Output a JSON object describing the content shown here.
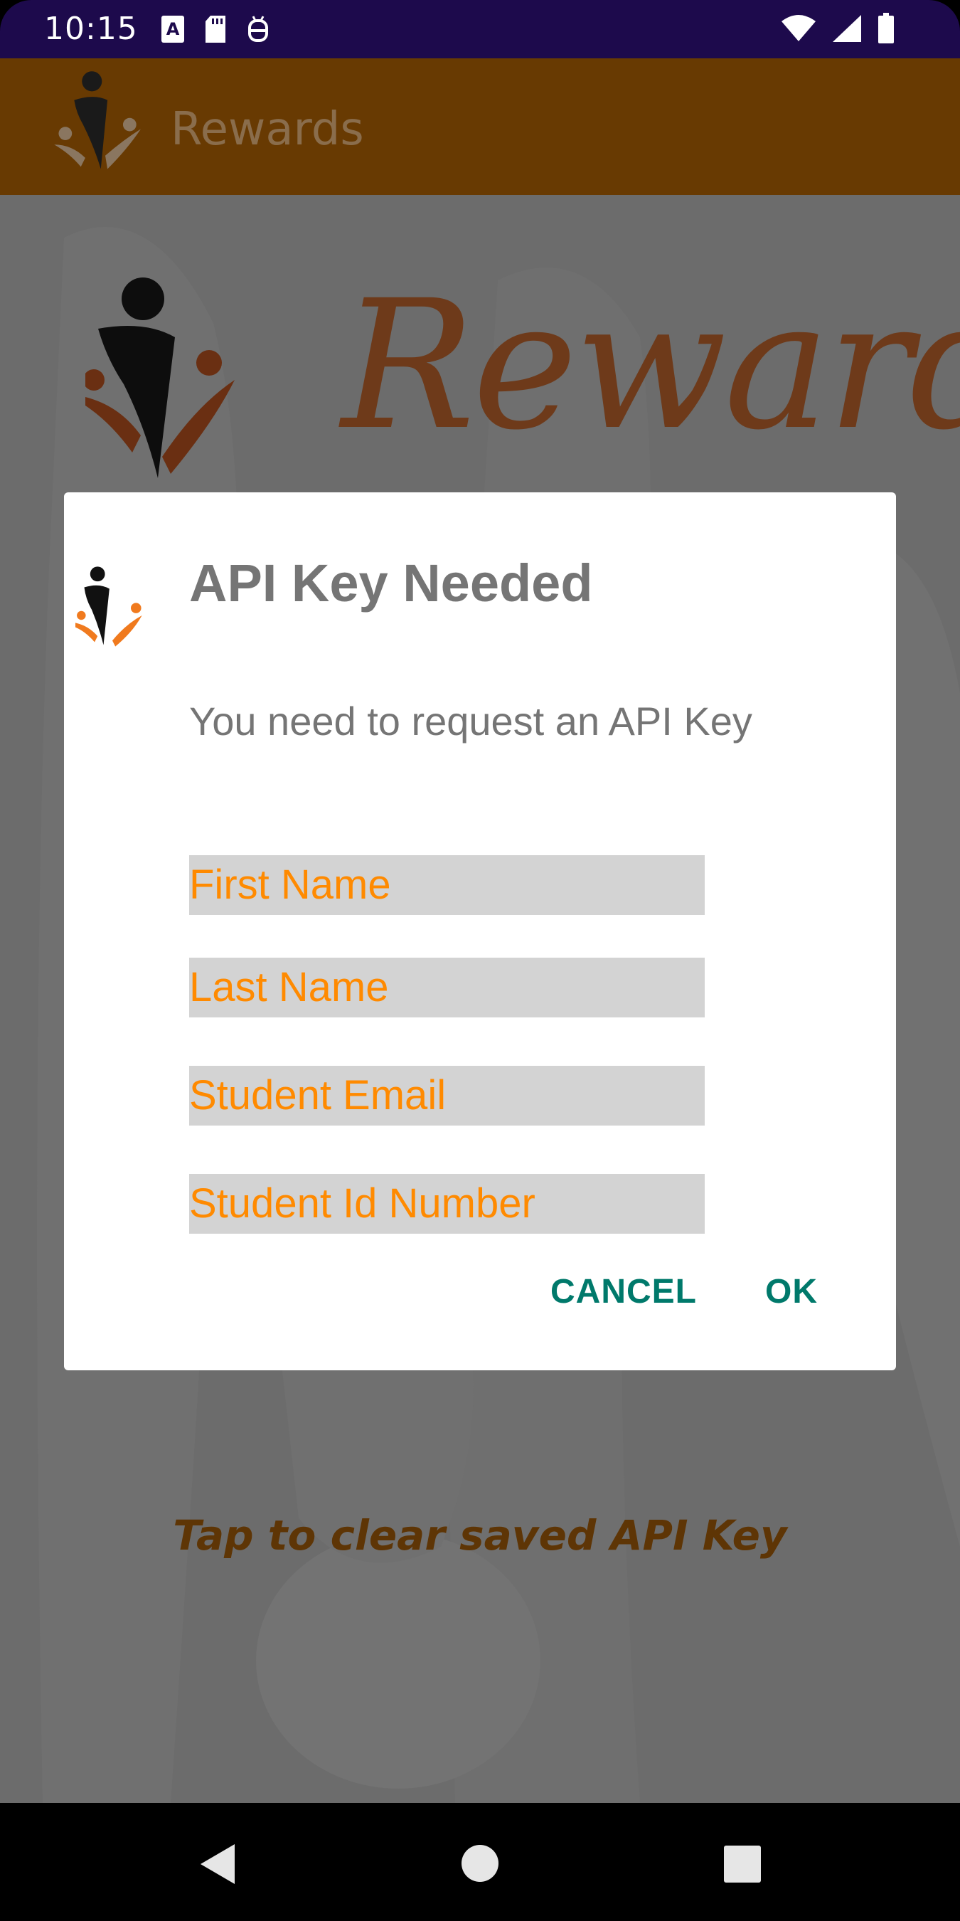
{
  "status_bar": {
    "time": "10:15",
    "left_icons": [
      "keyboard-a-icon",
      "sd-card-icon",
      "debug-icon"
    ],
    "right_icons": [
      "wifi-icon",
      "signal-icon",
      "battery-icon"
    ]
  },
  "app_bar": {
    "title": "Rewards",
    "logo_icon": "rewards-logo-icon"
  },
  "background": {
    "hero_word": "Rewards",
    "clear_key_link": "Tap to clear saved API Key"
  },
  "dialog": {
    "title": "API Key Needed",
    "message": "You need to request an API Key",
    "fields": {
      "first_name_placeholder": "First Name",
      "last_name_placeholder": "Last Name",
      "email_placeholder": "Student Email",
      "student_id_placeholder": "Student Id Number"
    },
    "cancel_label": "CANCEL",
    "ok_label": "OK"
  },
  "nav_bar": {
    "icons": [
      "back-icon",
      "home-icon",
      "recents-icon"
    ]
  },
  "colors": {
    "status_bar": "#1d0a4c",
    "app_bar": "#683a02",
    "field_text": "#ff8a00",
    "field_bg": "#d3d3d3",
    "dialog_button": "#00796b",
    "scrim": "#6c6c6c"
  }
}
